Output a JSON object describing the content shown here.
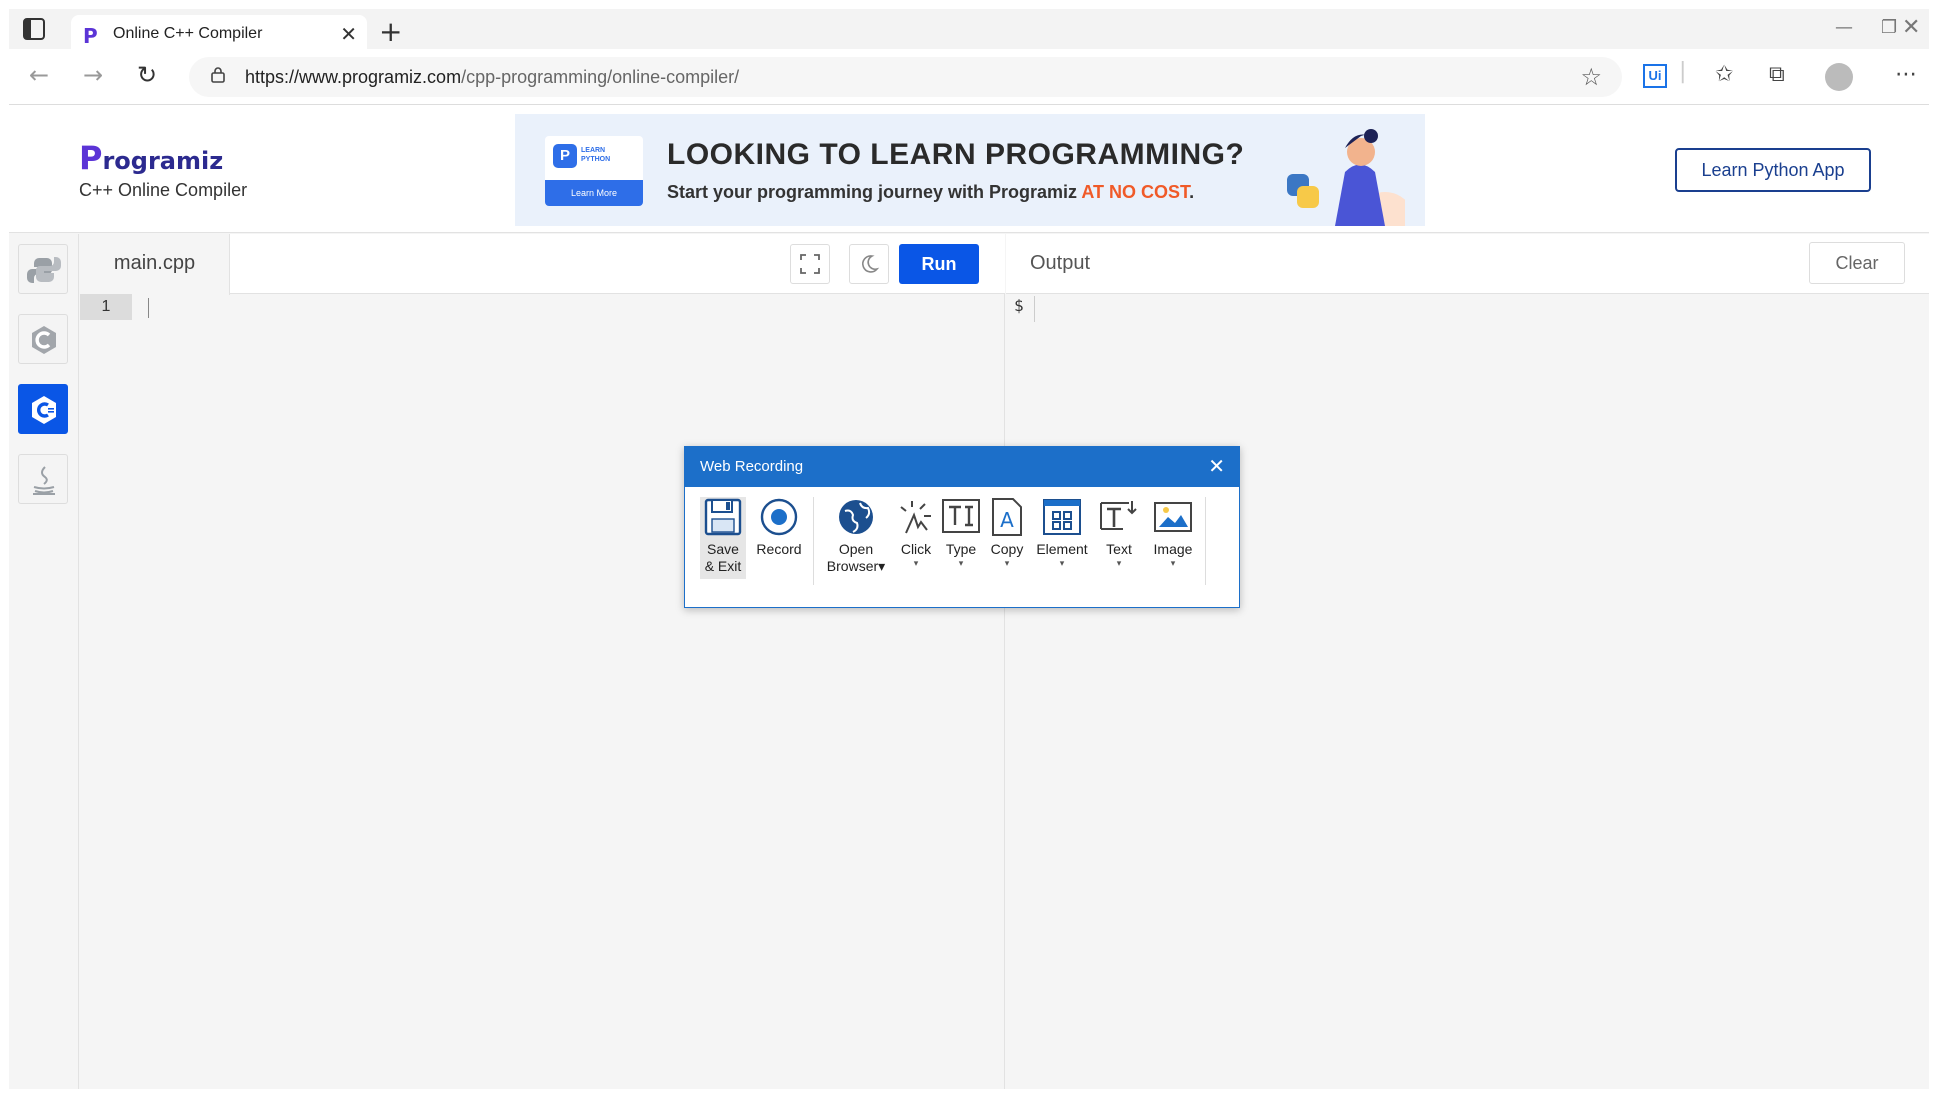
{
  "browser": {
    "tab_title": "Online C++ Compiler",
    "tab_close": "✕",
    "new_tab": "+",
    "url_host": "https://www.programiz.com",
    "url_path": "/cpp-programming/online-compiler/",
    "ext_label": "Ui"
  },
  "site": {
    "logo_first": "P",
    "logo_rest": "rogramiz",
    "subtitle": "C++ Online Compiler",
    "learn_button": "Learn Python App"
  },
  "banner": {
    "badge_letter": "P",
    "badge_text_1": "LEARN",
    "badge_text_2": "PYTHON",
    "learn_more": "Learn More",
    "headline": "LOOKING TO LEARN PROGRAMMING?",
    "sub_before": "Start your programming journey with Programiz ",
    "sub_cta": "AT NO COST",
    "sub_after": "."
  },
  "editor": {
    "file_tab": "main.cpp",
    "run_label": "Run",
    "line_number": "1"
  },
  "output": {
    "title": "Output",
    "clear_label": "Clear",
    "prompt": "$"
  },
  "dialog": {
    "title": "Web Recording",
    "tools": [
      {
        "name": "save-exit",
        "line1": "Save",
        "line2": "& Exit"
      },
      {
        "name": "record",
        "line1": "Record",
        "line2": ""
      },
      {
        "name": "open-browser",
        "line1": "Open",
        "line2": "Browser"
      },
      {
        "name": "click",
        "line1": "Click",
        "line2": ""
      },
      {
        "name": "type",
        "line1": "Type",
        "line2": ""
      },
      {
        "name": "copy",
        "line1": "Copy",
        "line2": ""
      },
      {
        "name": "element",
        "line1": "Element",
        "line2": ""
      },
      {
        "name": "text",
        "line1": "Text",
        "line2": ""
      },
      {
        "name": "image",
        "line1": "Image",
        "line2": ""
      }
    ]
  },
  "colors": {
    "accent": "#0a56e6",
    "dialog": "#1c6fc9",
    "cta": "#f05a28"
  }
}
